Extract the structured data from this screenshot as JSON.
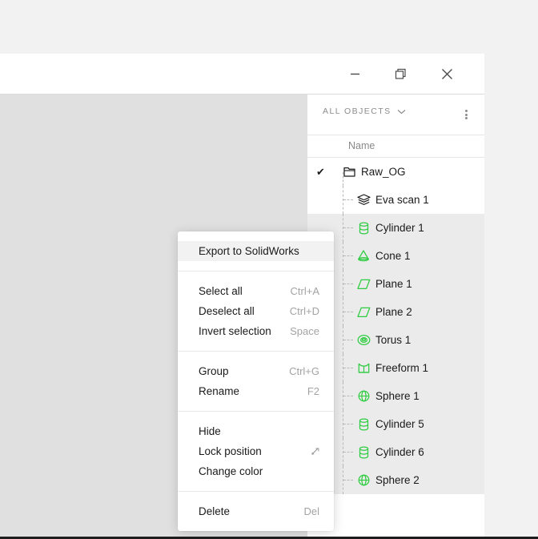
{
  "window": {
    "controls": [
      {
        "name": "minimize",
        "label": "Minimize"
      },
      {
        "name": "restore",
        "label": "Restore"
      },
      {
        "name": "close",
        "label": "Close"
      }
    ]
  },
  "panel": {
    "header_label": "ALL OBJECTS",
    "chevron_icon": "chevron-down-icon",
    "more_icon": "more-vertical-icon",
    "column_header": "Name"
  },
  "objects": [
    {
      "name": "Raw_OG",
      "icon": "folder-icon",
      "depth": 0,
      "checked": true,
      "selected": false
    },
    {
      "name": "Eva scan 1",
      "icon": "layers-icon",
      "depth": 1,
      "checked": false,
      "selected": false
    },
    {
      "name": "Cylinder 1",
      "icon": "cylinder-icon",
      "depth": 1,
      "checked": false,
      "selected": true
    },
    {
      "name": "Cone 1",
      "icon": "cone-icon",
      "depth": 1,
      "checked": false,
      "selected": true
    },
    {
      "name": "Plane 1",
      "icon": "plane-icon",
      "depth": 1,
      "checked": false,
      "selected": true
    },
    {
      "name": "Plane 2",
      "icon": "plane-icon",
      "depth": 1,
      "checked": false,
      "selected": true
    },
    {
      "name": "Torus 1",
      "icon": "torus-icon",
      "depth": 1,
      "checked": false,
      "selected": true
    },
    {
      "name": "Freeform 1",
      "icon": "freeform-icon",
      "depth": 1,
      "checked": false,
      "selected": true
    },
    {
      "name": "Sphere 1",
      "icon": "sphere-icon",
      "depth": 1,
      "checked": false,
      "selected": true
    },
    {
      "name": "Cylinder 5",
      "icon": "cylinder-icon",
      "depth": 1,
      "checked": false,
      "selected": true
    },
    {
      "name": "Cylinder 6",
      "icon": "cylinder-icon",
      "depth": 1,
      "checked": false,
      "selected": true
    },
    {
      "name": "Sphere 2",
      "icon": "sphere-icon",
      "depth": 1,
      "checked": true,
      "selected": true
    }
  ],
  "context_menu": {
    "groups": [
      [
        {
          "label": "Export to SolidWorks",
          "shortcut": "",
          "highlighted": true,
          "icon": ""
        }
      ],
      [
        {
          "label": "Select all",
          "shortcut": "Ctrl+A",
          "highlighted": false,
          "icon": ""
        },
        {
          "label": "Deselect all",
          "shortcut": "Ctrl+D",
          "highlighted": false,
          "icon": ""
        },
        {
          "label": "Invert selection",
          "shortcut": "Space",
          "highlighted": false,
          "icon": ""
        }
      ],
      [
        {
          "label": "Group",
          "shortcut": "Ctrl+G",
          "highlighted": false,
          "icon": ""
        },
        {
          "label": "Rename",
          "shortcut": "F2",
          "highlighted": false,
          "icon": ""
        }
      ],
      [
        {
          "label": "Hide",
          "shortcut": "",
          "highlighted": false,
          "icon": ""
        },
        {
          "label": "Lock position",
          "shortcut": "",
          "highlighted": false,
          "icon": "unlock-arrow-icon"
        },
        {
          "label": "Change color",
          "shortcut": "",
          "highlighted": false,
          "icon": ""
        }
      ],
      [
        {
          "label": "Delete",
          "shortcut": "Del",
          "highlighted": false,
          "icon": ""
        }
      ]
    ]
  },
  "colors": {
    "accent_green": "#2ecc40",
    "desktop_bg": "#f2f2f2",
    "viewport_bg": "#e0e0e0",
    "selection_bg": "#ebebeb",
    "menu_highlight": "#f2f2f2",
    "text_primary": "#1a1a1a",
    "text_muted": "#a3a3a3"
  }
}
